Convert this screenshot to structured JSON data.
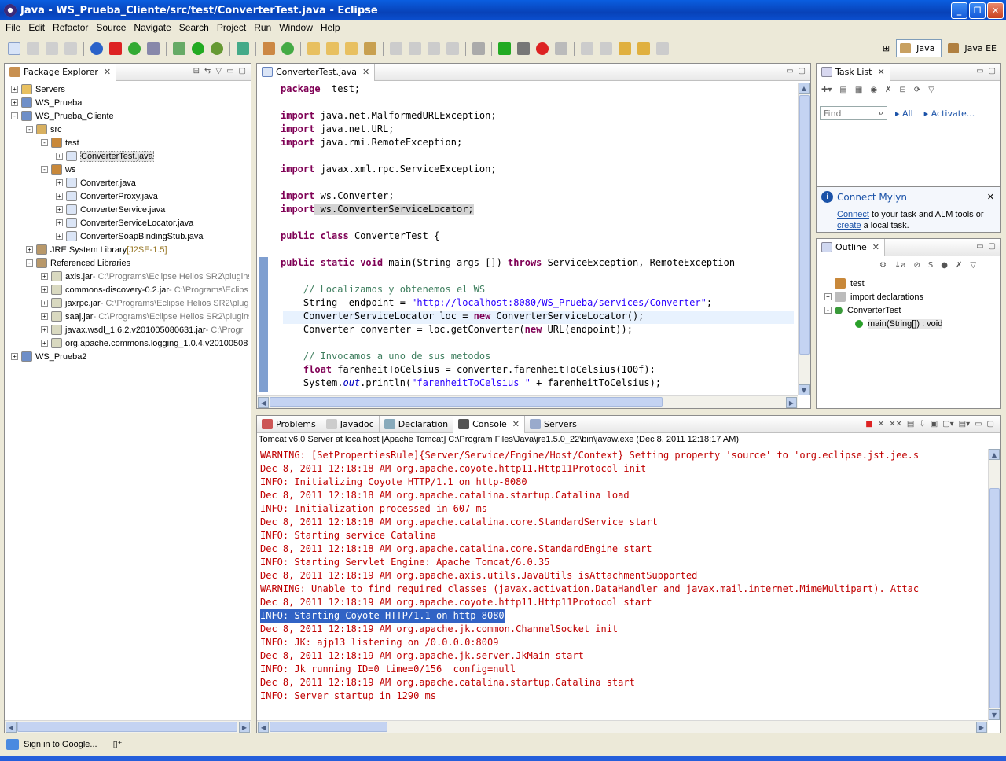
{
  "window": {
    "title": "Java - WS_Prueba_Cliente/src/test/ConverterTest.java - Eclipse"
  },
  "menu": [
    "File",
    "Edit",
    "Refactor",
    "Source",
    "Navigate",
    "Search",
    "Project",
    "Run",
    "Window",
    "Help"
  ],
  "perspectives": {
    "java": "Java",
    "javaee": "Java EE"
  },
  "package_explorer": {
    "title": "Package Explorer",
    "rows": [
      {
        "indent": 0,
        "exp": "+",
        "icon": "server-folder-icon",
        "label": "Servers",
        "extra": ""
      },
      {
        "indent": 0,
        "exp": "+",
        "icon": "project-icon",
        "label": "WS_Prueba",
        "extra": ""
      },
      {
        "indent": 0,
        "exp": "-",
        "icon": "project-icon",
        "label": "WS_Prueba_Cliente",
        "extra": ""
      },
      {
        "indent": 1,
        "exp": "-",
        "icon": "source-folder-icon",
        "label": "src",
        "extra": ""
      },
      {
        "indent": 2,
        "exp": "-",
        "icon": "package-icon",
        "label": "test",
        "extra": ""
      },
      {
        "indent": 3,
        "exp": "+",
        "icon": "java-file-icon",
        "label": "ConverterTest.java",
        "extra": "",
        "sel": true
      },
      {
        "indent": 2,
        "exp": "-",
        "icon": "package-icon",
        "label": "ws",
        "extra": ""
      },
      {
        "indent": 3,
        "exp": "+",
        "icon": "java-file-icon",
        "label": "Converter.java",
        "extra": ""
      },
      {
        "indent": 3,
        "exp": "+",
        "icon": "java-file-icon",
        "label": "ConverterProxy.java",
        "extra": ""
      },
      {
        "indent": 3,
        "exp": "+",
        "icon": "java-file-icon",
        "label": "ConverterService.java",
        "extra": ""
      },
      {
        "indent": 3,
        "exp": "+",
        "icon": "java-file-icon",
        "label": "ConverterServiceLocator.java",
        "extra": ""
      },
      {
        "indent": 3,
        "exp": "+",
        "icon": "java-file-icon",
        "label": "ConverterSoapBindingStub.java",
        "extra": ""
      },
      {
        "indent": 1,
        "exp": "+",
        "icon": "library-icon",
        "label": "JRE System Library",
        "extra": " [J2SE-1.5]"
      },
      {
        "indent": 1,
        "exp": "-",
        "icon": "library-icon",
        "label": "Referenced Libraries",
        "extra": ""
      },
      {
        "indent": 2,
        "exp": "+",
        "icon": "jar-icon",
        "label": "axis.jar",
        "extra": " - C:\\Programs\\Eclipse Helios SR2\\plugins"
      },
      {
        "indent": 2,
        "exp": "+",
        "icon": "jar-icon",
        "label": "commons-discovery-0.2.jar",
        "extra": " - C:\\Programs\\Eclips"
      },
      {
        "indent": 2,
        "exp": "+",
        "icon": "jar-icon",
        "label": "jaxrpc.jar",
        "extra": " - C:\\Programs\\Eclipse Helios SR2\\plugi"
      },
      {
        "indent": 2,
        "exp": "+",
        "icon": "jar-icon",
        "label": "saaj.jar",
        "extra": " - C:\\Programs\\Eclipse Helios SR2\\plugins"
      },
      {
        "indent": 2,
        "exp": "+",
        "icon": "jar-icon",
        "label": "javax.wsdl_1.6.2.v201005080631.jar",
        "extra": " - C:\\Progr"
      },
      {
        "indent": 2,
        "exp": "+",
        "icon": "jar-icon",
        "label": "org.apache.commons.logging_1.0.4.v20100508",
        "extra": ""
      },
      {
        "indent": 0,
        "exp": "+",
        "icon": "project-icon",
        "label": "WS_Prueba2",
        "extra": ""
      }
    ]
  },
  "editor": {
    "tab": "ConverterTest.java",
    "lines": [
      [
        [
          "kw",
          "package"
        ],
        [
          "",
          "  test;"
        ]
      ],
      [
        [
          "",
          ""
        ]
      ],
      [
        [
          "kw",
          "import"
        ],
        [
          "",
          " java.net.MalformedURLException;"
        ]
      ],
      [
        [
          "kw",
          "import"
        ],
        [
          "",
          " java.net.URL;"
        ]
      ],
      [
        [
          "kw",
          "import"
        ],
        [
          "",
          " java.rmi.RemoteException;"
        ]
      ],
      [
        [
          "",
          ""
        ]
      ],
      [
        [
          "kw",
          "import"
        ],
        [
          "",
          " javax.xml.rpc.ServiceException;"
        ]
      ],
      [
        [
          "",
          ""
        ]
      ],
      [
        [
          "kw",
          "import"
        ],
        [
          "",
          " ws.Converter;"
        ]
      ],
      [
        [
          "kw",
          "import"
        ],
        [
          "",
          " ws.ConverterServiceLocator;"
        ]
      ],
      [
        [
          "",
          ""
        ]
      ],
      [
        [
          "kw",
          "public"
        ],
        [
          "",
          " "
        ],
        [
          "kw",
          "class"
        ],
        [
          "",
          " ConverterTest {"
        ]
      ],
      [
        [
          "",
          ""
        ]
      ],
      [
        [
          "kw",
          "public"
        ],
        [
          "",
          " "
        ],
        [
          "kw",
          "static"
        ],
        [
          "",
          " "
        ],
        [
          "kw",
          "void"
        ],
        [
          "",
          " main(String args []) "
        ],
        [
          "kw",
          "throws"
        ],
        [
          "",
          " ServiceException, RemoteException"
        ]
      ],
      [
        [
          "",
          ""
        ]
      ],
      [
        [
          "",
          "    "
        ],
        [
          "cm",
          "// Localizamos y obtenemos el WS"
        ]
      ],
      [
        [
          "",
          "    String  endpoint = "
        ],
        [
          "str",
          "\"http://localhost:8080/WS_Prueba/services/Converter\""
        ],
        [
          "",
          ";"
        ]
      ],
      [
        [
          "",
          "    ConverterServiceLocator loc = "
        ],
        [
          "kw",
          "new"
        ],
        [
          "",
          " ConverterServiceLocator();"
        ]
      ],
      [
        [
          "",
          "    Converter converter = loc.getConverter("
        ],
        [
          "kw",
          "new"
        ],
        [
          "",
          " URL(endpoint));"
        ]
      ],
      [
        [
          "",
          ""
        ]
      ],
      [
        [
          "",
          "    "
        ],
        [
          "cm",
          "// Invocamos a uno de sus metodos"
        ]
      ],
      [
        [
          "",
          "    "
        ],
        [
          "kw",
          "float"
        ],
        [
          "",
          " farenheitToCelsius = converter.farenheitToCelsius(100f);"
        ]
      ],
      [
        [
          "",
          "    System."
        ],
        [
          "cm",
          "out"
        ],
        [
          "",
          ".println("
        ],
        [
          "str",
          "\"farenheitToCelsius \""
        ],
        [
          "",
          " + farenheitToCelsius);"
        ]
      ]
    ]
  },
  "tasklist": {
    "title": "Task List",
    "find_placeholder": "Find",
    "all": "All",
    "activate": "Activate..."
  },
  "mylyn": {
    "title": "Connect Mylyn",
    "text1": "Connect",
    "text2": " to your task and ALM tools or",
    "text3": "create",
    "text4": " a local task."
  },
  "outline": {
    "title": "Outline",
    "rows": [
      {
        "exp": "",
        "icon": "package-icon",
        "label": "test",
        "indent": 0
      },
      {
        "exp": "+",
        "icon": "imports-icon",
        "label": "import declarations",
        "indent": 0
      },
      {
        "exp": "-",
        "icon": "class-icon",
        "label": "ConverterTest",
        "indent": 0
      },
      {
        "exp": "",
        "icon": "method-icon",
        "label": "main(String[]) : void",
        "indent": 1
      }
    ]
  },
  "bottom": {
    "tabs": [
      "Problems",
      "Javadoc",
      "Declaration",
      "Console",
      "Servers"
    ],
    "console_header": "Tomcat v6.0 Server at localhost [Apache Tomcat] C:\\Program Files\\Java\\jre1.5.0_22\\bin\\javaw.exe (Dec 8, 2011 12:18:17 AM)",
    "console_lines": [
      "WARNING: [SetPropertiesRule]{Server/Service/Engine/Host/Context} Setting property 'source' to 'org.eclipse.jst.jee.s",
      "Dec 8, 2011 12:18:18 AM org.apache.coyote.http11.Http11Protocol init",
      "INFO: Initializing Coyote HTTP/1.1 on http-8080",
      "Dec 8, 2011 12:18:18 AM org.apache.catalina.startup.Catalina load",
      "INFO: Initialization processed in 607 ms",
      "Dec 8, 2011 12:18:18 AM org.apache.catalina.core.StandardService start",
      "INFO: Starting service Catalina",
      "Dec 8, 2011 12:18:18 AM org.apache.catalina.core.StandardEngine start",
      "INFO: Starting Servlet Engine: Apache Tomcat/6.0.35",
      "Dec 8, 2011 12:18:19 AM org.apache.axis.utils.JavaUtils isAttachmentSupported",
      "WARNING: Unable to find required classes (javax.activation.DataHandler and javax.mail.internet.MimeMultipart). Attac",
      "Dec 8, 2011 12:18:19 AM org.apache.coyote.http11.Http11Protocol start",
      "INFO: Starting Coyote HTTP/1.1 on http-8080",
      "Dec 8, 2011 12:18:19 AM org.apache.jk.common.ChannelSocket init",
      "INFO: JK: ajp13 listening on /0.0.0.0:8009",
      "Dec 8, 2011 12:18:19 AM org.apache.jk.server.JkMain start",
      "INFO: Jk running ID=0 time=0/156  config=null",
      "Dec 8, 2011 12:18:19 AM org.apache.catalina.startup.Catalina start",
      "INFO: Server startup in 1290 ms"
    ],
    "highlight_index": 12
  },
  "status": {
    "text": "Sign in to Google..."
  },
  "colors": {
    "keyword": "#7f0055",
    "string": "#2a00ff",
    "comment": "#3f7f5f",
    "console": "#c00000",
    "selection": "#3163c5"
  }
}
